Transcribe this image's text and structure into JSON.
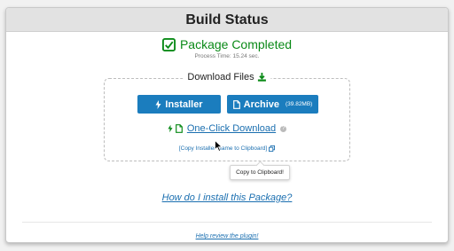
{
  "header": {
    "title": "Build Status"
  },
  "status": {
    "text": "Package Completed",
    "process_time": "Process Time: 15.24 sec."
  },
  "download": {
    "legend": "Download Files",
    "installer_label": "Installer",
    "archive_label": "Archive",
    "archive_size": "(39.82MB)",
    "oneclick_label": "One-Click Download",
    "copy_label": "[Copy Installer Name to Clipboard]",
    "tooltip": "Copy to Clipboard!"
  },
  "links": {
    "install_help": "How do I install this Package?",
    "review": "Help review the plugin!"
  },
  "colors": {
    "accent": "#1b7dbe",
    "success": "#0a8a17",
    "link": "#1b6fb0"
  }
}
